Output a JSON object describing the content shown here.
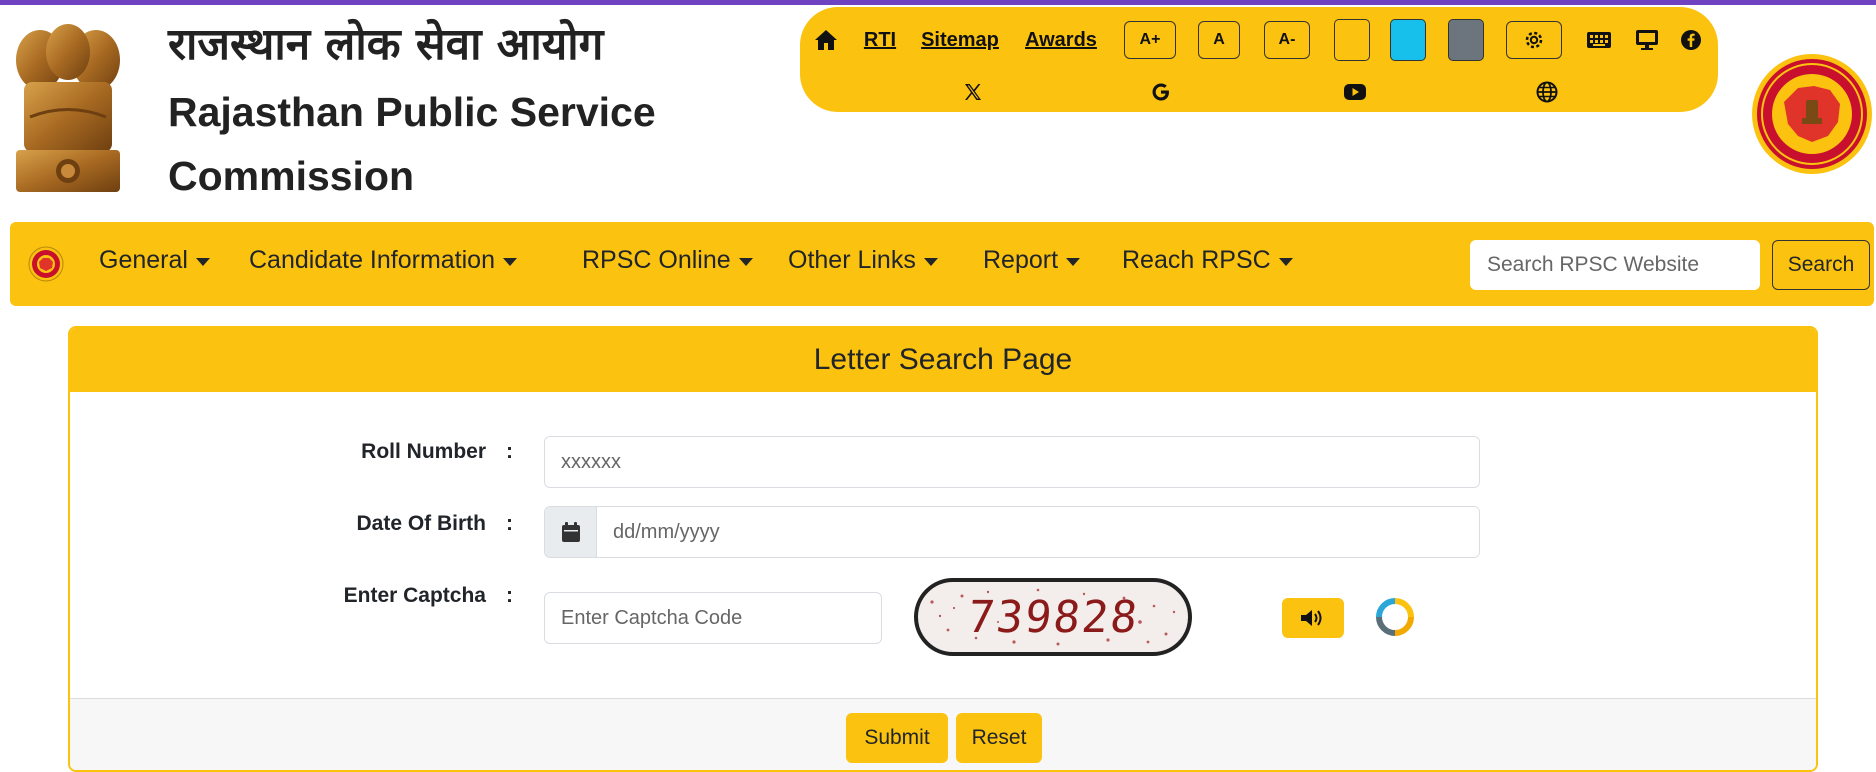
{
  "header": {
    "title_hindi": "राजस्थान लोक सेवा आयोग",
    "title_english": "Rajasthan Public Service Commission"
  },
  "utility_bar": {
    "links": [
      "RTI",
      "Sitemap",
      "Awards"
    ],
    "font_buttons": [
      "A+",
      "A",
      "A-"
    ],
    "swatches": [
      "#fbc20f",
      "#17c0eb",
      "#6c757d"
    ],
    "icons": [
      "home-icon",
      "gear-icon",
      "keyboard-icon",
      "monitor-icon",
      "facebook-icon",
      "x-twitter-icon",
      "google-icon",
      "youtube-icon",
      "globe-icon"
    ]
  },
  "nav": {
    "items": [
      "General",
      "Candidate Information",
      "RPSC Online",
      "Other Links",
      "Report",
      "Reach RPSC"
    ],
    "search_placeholder": "Search RPSC Website",
    "search_button": "Search"
  },
  "form": {
    "title": "Letter Search Page",
    "roll_label": "Roll Number",
    "roll_placeholder": "xxxxxx",
    "dob_label": "Date Of Birth",
    "dob_placeholder": "dd/mm/yyyy",
    "captcha_label": "Enter Captcha",
    "captcha_placeholder": "Enter Captcha Code",
    "captcha_code": "739828",
    "colon": ":",
    "submit": "Submit",
    "reset": "Reset"
  },
  "colors": {
    "accent": "#fbc20f",
    "top_line": "#6f42c1",
    "captcha_text": "#8b1a1a"
  }
}
